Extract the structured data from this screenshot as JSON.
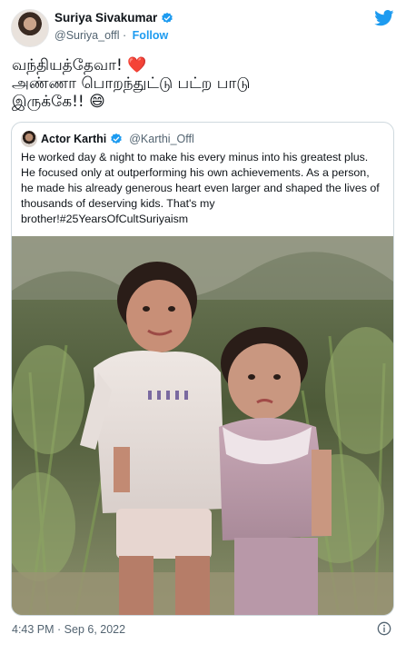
{
  "tweet": {
    "author_name": "Suriya Sivakumar",
    "author_handle": "@Suriya_offl",
    "separator": "·",
    "follow_label": "Follow",
    "text_line1": "வந்தியத்தேவா!",
    "heart_emoji": "❤️",
    "text_line2": "அண்ணா பொறந்துட்டு பட்ற பாடு",
    "text_line3": "இருக்கே!!",
    "smile_emoji": "😄",
    "timestamp": "4:43 PM · Sep 6, 2022"
  },
  "quoted_tweet": {
    "author_name": "Actor Karthi",
    "author_handle": "@Karthi_Offl",
    "lines": [
      "He worked day & night to make his every minus into his greatest plus.",
      "He focused only at outperforming his own achievements. As a person,",
      "he made his already generous heart even larger and shaped the lives of",
      "thousands of deserving kids. That's my",
      "brother!#25YearsOfCultSuriyaism"
    ]
  },
  "icons": {
    "verified": "verified-badge-icon",
    "brand": "twitter-bird-icon",
    "info": "info-icon"
  },
  "colors": {
    "accent": "#1d9bf0",
    "text": "#0f1419",
    "secondary": "#536471",
    "border": "#cfd9de"
  }
}
